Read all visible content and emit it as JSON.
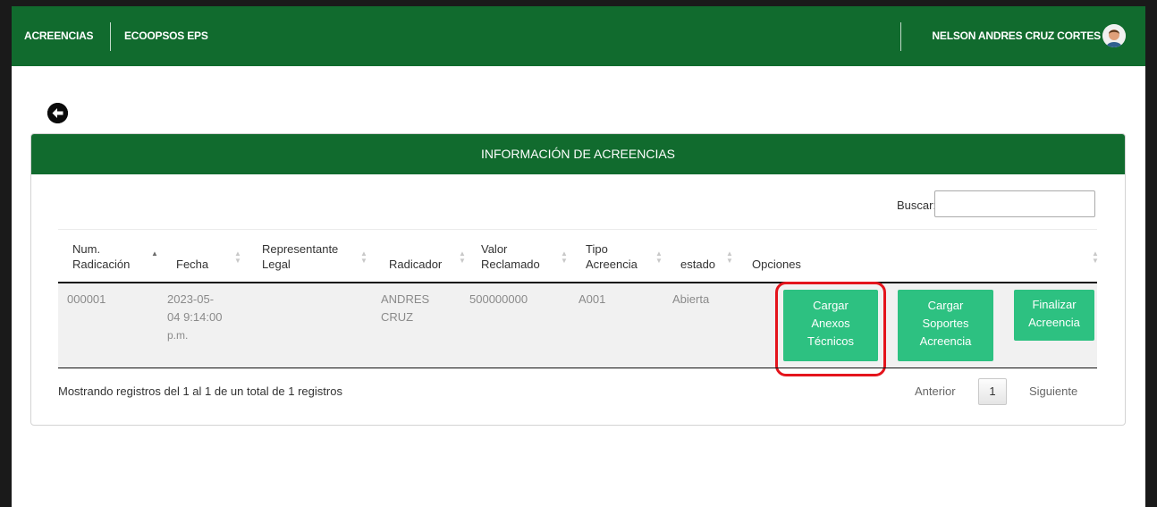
{
  "nav": {
    "item1": "ACREENCIAS",
    "item2": "ECOOPSOS EPS"
  },
  "user": {
    "name": "NELSON ANDRES CRUZ CORTES"
  },
  "card": {
    "title": "INFORMACIÓN DE ACREENCIAS"
  },
  "search": {
    "label": "Buscar:",
    "value": ""
  },
  "table": {
    "columns": [
      {
        "line1": "Num.",
        "line2": "Radicación"
      },
      {
        "line1": "",
        "line2": "Fecha"
      },
      {
        "line1": "Representante",
        "line2": "Legal"
      },
      {
        "line1": "",
        "line2": "Radicador"
      },
      {
        "line1": "Valor",
        "line2": "Reclamado"
      },
      {
        "line1": "Tipo",
        "line2": "Acreencia"
      },
      {
        "line1": "",
        "line2": "estado"
      },
      {
        "line1": "",
        "line2": "Opciones"
      }
    ],
    "rows": [
      {
        "num": "000001",
        "fecha_1": "2023-05-",
        "fecha_2": "04 9:14:00",
        "fecha_3": "p.m.",
        "representante": "",
        "radicador_1": "ANDRES",
        "radicador_2": "CRUZ",
        "valor": "500000000",
        "tipo": "A001",
        "estado": "Abierta",
        "btn_anexos": [
          "Cargar",
          "Anexos",
          "Técnicos"
        ],
        "btn_soportes": [
          "Cargar",
          "Soportes",
          "Acreencia"
        ],
        "btn_finalizar": [
          "Finalizar",
          "Acreencia"
        ]
      }
    ]
  },
  "footer": {
    "info": "Mostrando registros del 1 al 1 de un total de 1 registros",
    "prev": "Anterior",
    "page": "1",
    "next": "Siguiente"
  },
  "icons": {
    "back": "arrow-left-circle-icon",
    "avatar": "user-avatar-icon",
    "sort": "sort-arrows-icon"
  },
  "colors": {
    "brand": "#116b2e",
    "button": "#2dc181",
    "highlight": "#e4141c"
  }
}
